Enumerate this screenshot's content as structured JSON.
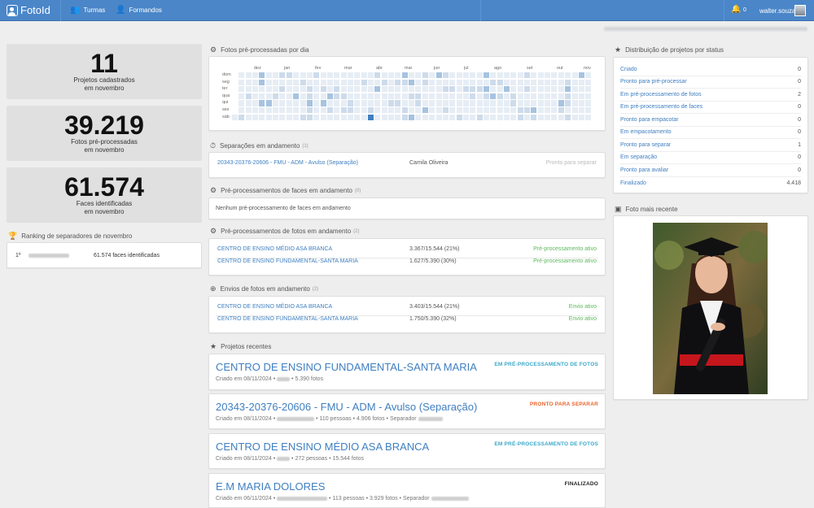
{
  "app": {
    "logo": "FotoId",
    "nav_turmas": "Turmas",
    "nav_formandos": "Formandos",
    "notif_count": "0",
    "username": "walter.souza"
  },
  "stats": [
    {
      "value": "11",
      "label1": "Projetos cadastrados",
      "label2": "em novembro"
    },
    {
      "value": "39.219",
      "label1": "Fotos pré-processadas",
      "label2": "em novembro"
    },
    {
      "value": "61.574",
      "label1": "Faces identificadas",
      "label2": "em novembro"
    }
  ],
  "ranking": {
    "title": "Ranking de separadores de novembro",
    "rows": [
      {
        "pos": "1º",
        "faces": "61.574 faces identificadas"
      }
    ]
  },
  "heatmap": {
    "title": "Fotos pré-processadas por dia",
    "months": [
      "dez",
      "jan",
      "fev",
      "mar",
      "abr",
      "mai",
      "jun",
      "jul",
      "ago",
      "set",
      "out",
      "nov"
    ],
    "days": [
      "dom",
      "seg",
      "ter",
      "qua",
      "qui",
      "sex",
      "sáb"
    ],
    "color_empty": "#e6edf5",
    "color_low": "#cddbeb",
    "color_mid": "#a6c3e0",
    "color_high": "#3f7fc1"
  },
  "separacoes": {
    "title": "Separações em andamento",
    "count": "(1)",
    "rows": [
      {
        "name": "20343-20376-20606 - FMU - ADM - Avulso (Separação)",
        "person": "Camila Oliveira",
        "status": "Pronto para separar"
      }
    ]
  },
  "preproc_faces": {
    "title": "Pré-processamentos de faces em andamento",
    "count": "(0)",
    "empty": "Nenhum pré-processamento de faces em andamento"
  },
  "preproc_fotos": {
    "title": "Pré-processamentos de fotos em andamento",
    "count": "(2)",
    "rows": [
      {
        "name": "CENTRO DE ENSINO MÉDIO ASA BRANCA",
        "progress": "3.367/15.544 (21%)",
        "status": "Pré-processamento ativo"
      },
      {
        "name": "CENTRO DE ENSINO FUNDAMENTAL-SANTA MARIA",
        "progress": "1.627/5.390 (30%)",
        "status": "Pré-processamento ativo"
      }
    ]
  },
  "envios": {
    "title": "Envios de fotos em andamento",
    "count": "(2)",
    "rows": [
      {
        "name": "CENTRO DE ENSINO MÉDIO ASA BRANCA",
        "progress": "3.403/15.544 (21%)",
        "status": "Envio ativo"
      },
      {
        "name": "CENTRO DE ENSINO FUNDAMENTAL-SANTA MARIA",
        "progress": "1.750/5.390 (32%)",
        "status": "Envio ativo"
      }
    ]
  },
  "recentes": {
    "title": "Projetos recentes",
    "items": [
      {
        "title": "CENTRO DE ENSINO FUNDAMENTAL-SANTA MARIA",
        "created": "Criado em 08/11/2024",
        "meta": "• 5.390 fotos",
        "status": "EM PRÉ-PROCESSAMENTO DE FOTOS",
        "color": "#3aa8c9"
      },
      {
        "title": "20343-20376-20606 - FMU - ADM - Avulso (Separação)",
        "created": "Criado em 08/11/2024",
        "meta": "• 110 pessoas • 4.906 fotos • Separador",
        "status": "PRONTO PARA SEPARAR",
        "color": "#e8632b"
      },
      {
        "title": "CENTRO DE ENSINO MÉDIO ASA BRANCA",
        "created": "Criado em 08/11/2024",
        "meta": "• 272 pessoas • 15.544 fotos",
        "status": "EM PRÉ-PROCESSAMENTO DE FOTOS",
        "color": "#3aa8c9"
      },
      {
        "title": "E.M MARIA DOLORES",
        "created": "Criado em 06/11/2024",
        "meta": "• 113 pessoas • 3.929 fotos • Separador",
        "status": "FINALIZADO",
        "color": "#222222"
      }
    ]
  },
  "distribuicao": {
    "title": "Distribuição de projetos por status",
    "rows": [
      {
        "label": "Criado",
        "value": "0"
      },
      {
        "label": "Pronto para pré-processar",
        "value": "0"
      },
      {
        "label": "Em pré-processamento de fotos",
        "value": "2"
      },
      {
        "label": "Em pré-processamento de faces",
        "value": "0"
      },
      {
        "label": "Pronto para empacotar",
        "value": "0"
      },
      {
        "label": "Em empacotamento",
        "value": "0"
      },
      {
        "label": "Pronto para separar",
        "value": "1"
      },
      {
        "label": "Em separação",
        "value": "0"
      },
      {
        "label": "Pronto para avaliar",
        "value": "0"
      },
      {
        "label": "Finalizado",
        "value": "4.418"
      }
    ]
  },
  "foto": {
    "title": "Foto mais recente"
  }
}
